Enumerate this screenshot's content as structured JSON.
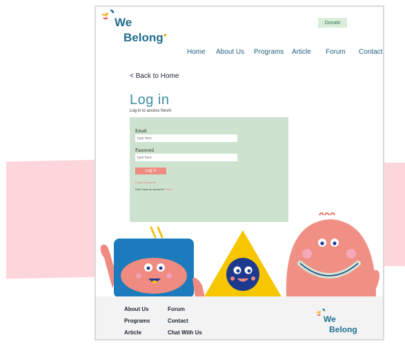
{
  "header": {
    "logo_word1": "We",
    "logo_word2": "Belong",
    "donate_label": "Donate",
    "nav": [
      "Home",
      "About Us",
      "Programs",
      "Article",
      "Forum",
      "Contact"
    ]
  },
  "back_link": "< Back to Home",
  "login": {
    "title": "Log in",
    "subtitle": "Log in to access forum",
    "email_label": "Email",
    "email_placeholder": "type here",
    "password_label": "Password",
    "password_placeholder": "type here",
    "button_label": "Log in",
    "forgot_label": "Forgot Password",
    "no_account_text": "Don't have an account? ",
    "signup_label": "Login"
  },
  "footer": {
    "links": [
      "About Us",
      "Forum",
      "Programs",
      "Contact",
      "Article",
      "Chat With Us"
    ],
    "logo_word1": "We",
    "logo_word2": "Belong"
  },
  "colors": {
    "brand_blue": "#1f6e8f",
    "title_teal": "#3b8ca4",
    "card_green": "#cde3cf",
    "button_coral": "#ef8b80",
    "pink_band": "#fdd6dc"
  }
}
